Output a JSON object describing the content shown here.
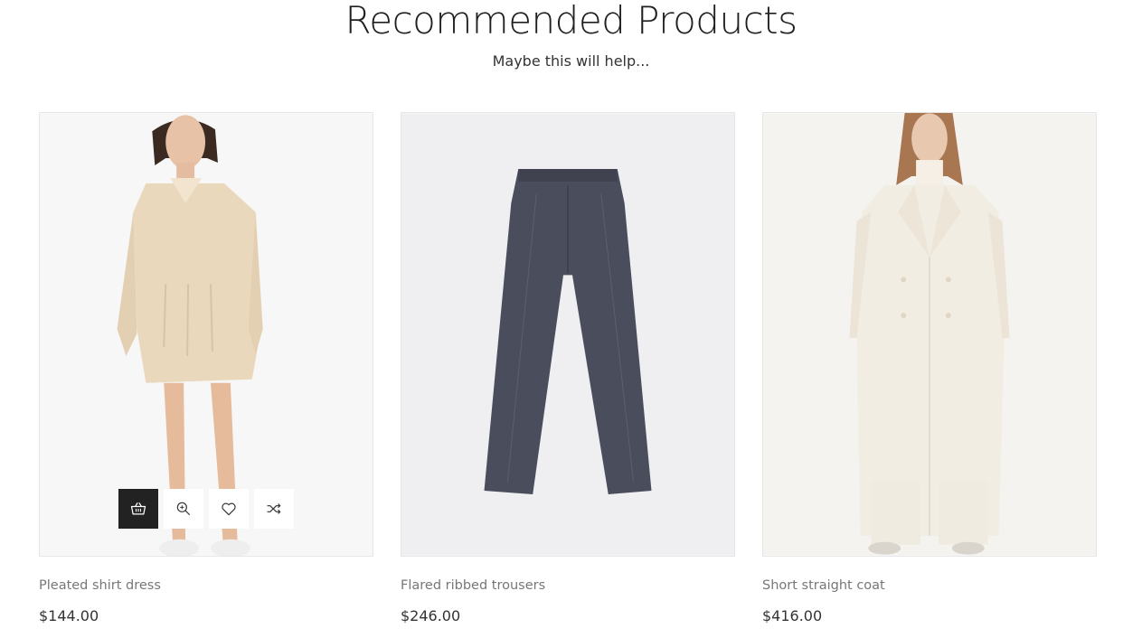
{
  "section": {
    "title": "Recommended Products",
    "subtitle": "Maybe this will help..."
  },
  "colors": {
    "dark_button": "#222222",
    "image_background": "#f2f2f2",
    "name_text": "#777777"
  },
  "products": [
    {
      "name": "Pleated shirt dress",
      "price": "$144.00",
      "image_icon": "shirt-dress-photo",
      "actions": [
        "basket-icon",
        "zoom-icon",
        "heart-icon",
        "shuffle-icon"
      ]
    },
    {
      "name": "Flared ribbed trousers",
      "price": "$246.00",
      "image_icon": "trousers-photo"
    },
    {
      "name": "Short straight coat",
      "price": "$416.00",
      "image_icon": "coat-photo"
    }
  ]
}
